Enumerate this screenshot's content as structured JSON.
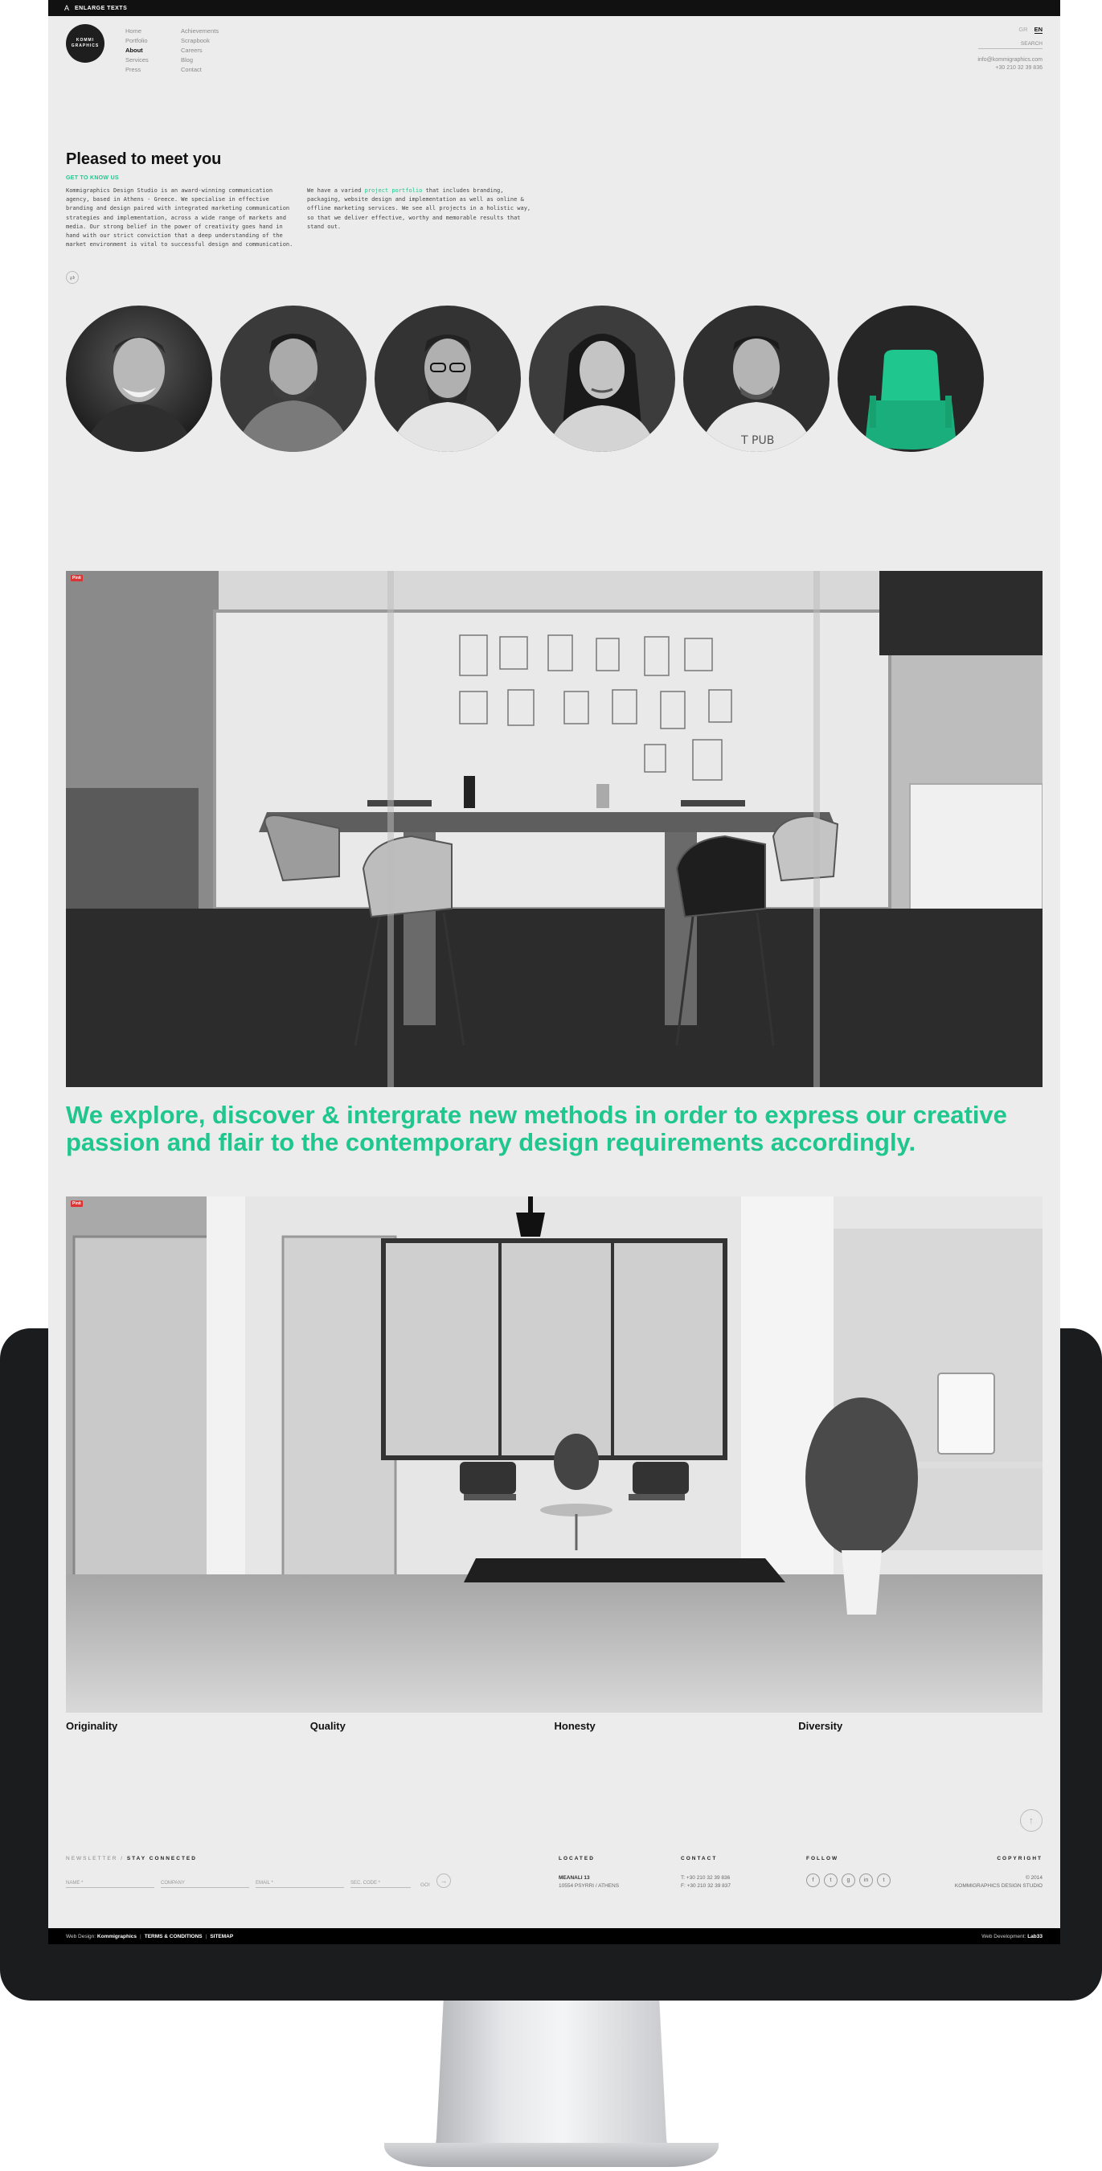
{
  "topbar": {
    "enlarge_label": "ENLARGE TEXTS"
  },
  "logo": {
    "text": "KOMMI GRAPHICS"
  },
  "nav": {
    "col1": [
      {
        "label": "Home",
        "active": false
      },
      {
        "label": "Portfolio",
        "active": false
      },
      {
        "label": "About",
        "active": true
      },
      {
        "label": "Services",
        "active": false
      },
      {
        "label": "Press",
        "active": false
      }
    ],
    "col2": [
      {
        "label": "Achievements"
      },
      {
        "label": "Scrapbook"
      },
      {
        "label": "Careers"
      },
      {
        "label": "Blog"
      },
      {
        "label": "Contact"
      }
    ]
  },
  "lang": {
    "gr": "GR",
    "en": "EN"
  },
  "search": {
    "label": "SEARCH"
  },
  "header_contact": {
    "email": "info@kommigraphics.com",
    "phone": "+30 210 32 39 836"
  },
  "about": {
    "title": "Pleased to meet you",
    "subtitle": "GET TO KNOW US",
    "para1": "Kommigraphics Design Studio is an award-winning communication agency, based in Athens - Greece. We specialise in effective branding and design paired with integrated marketing communication strategies and implementation, across a wide range of markets and media. Our strong belief in the power of creativity goes hand in hand with our strict conviction that a deep understanding of the market environment is vital to successful design and communication.",
    "para2_pre": "We have a varied ",
    "para2_link": "project portfolio",
    "para2_post": " that includes branding, packaging, website design and implementation as well as online & offline marketing services. We see all projects in a holistic way, so that we deliver effective, worthy and memorable results that stand out."
  },
  "headline": "We explore, discover & intergrate new methods in order to express our creative passion and flair to the contemporary design requirements accordingly.",
  "photo_tag": "Pinit",
  "values": [
    "Originality",
    "Quality",
    "Honesty",
    "Diversity"
  ],
  "footer": {
    "newsletter": "NEWSLETTER",
    "newsletter_sep": " / ",
    "stay": "STAY CONNECTED",
    "fields": [
      "NAME *",
      "COMPANY",
      "EMAIL *",
      "SEC. CODE *"
    ],
    "go": "GO!",
    "located_head": "LOCATED",
    "located_l1": "MEANALI 13",
    "located_l2": "10554 PSYRRI / ATHENS",
    "contact_head": "CONTACT",
    "contact_t": "T: +30 210 32 39 836",
    "contact_f": "F: +30 210 32 39 837",
    "follow_head": "FOLLOW",
    "social": [
      "f",
      "t",
      "g",
      "in",
      "t"
    ],
    "copyright_head": "COPYRIGHT",
    "copyright_l1": "© 2014",
    "copyright_l2": "KOMMIGRAPHICS DESIGN STUDIO"
  },
  "bottom": {
    "design_pre": "Web Design: ",
    "design_by": "Kommigraphics",
    "terms": "TERMS & CONDITIONS",
    "sitemap": "SITEMAP",
    "dev_pre": "Web Development: ",
    "dev_by": "Lab33"
  },
  "colors": {
    "accent": "#1fc68e",
    "page_bg": "#ececec",
    "monitor": "#1b1c1e"
  }
}
